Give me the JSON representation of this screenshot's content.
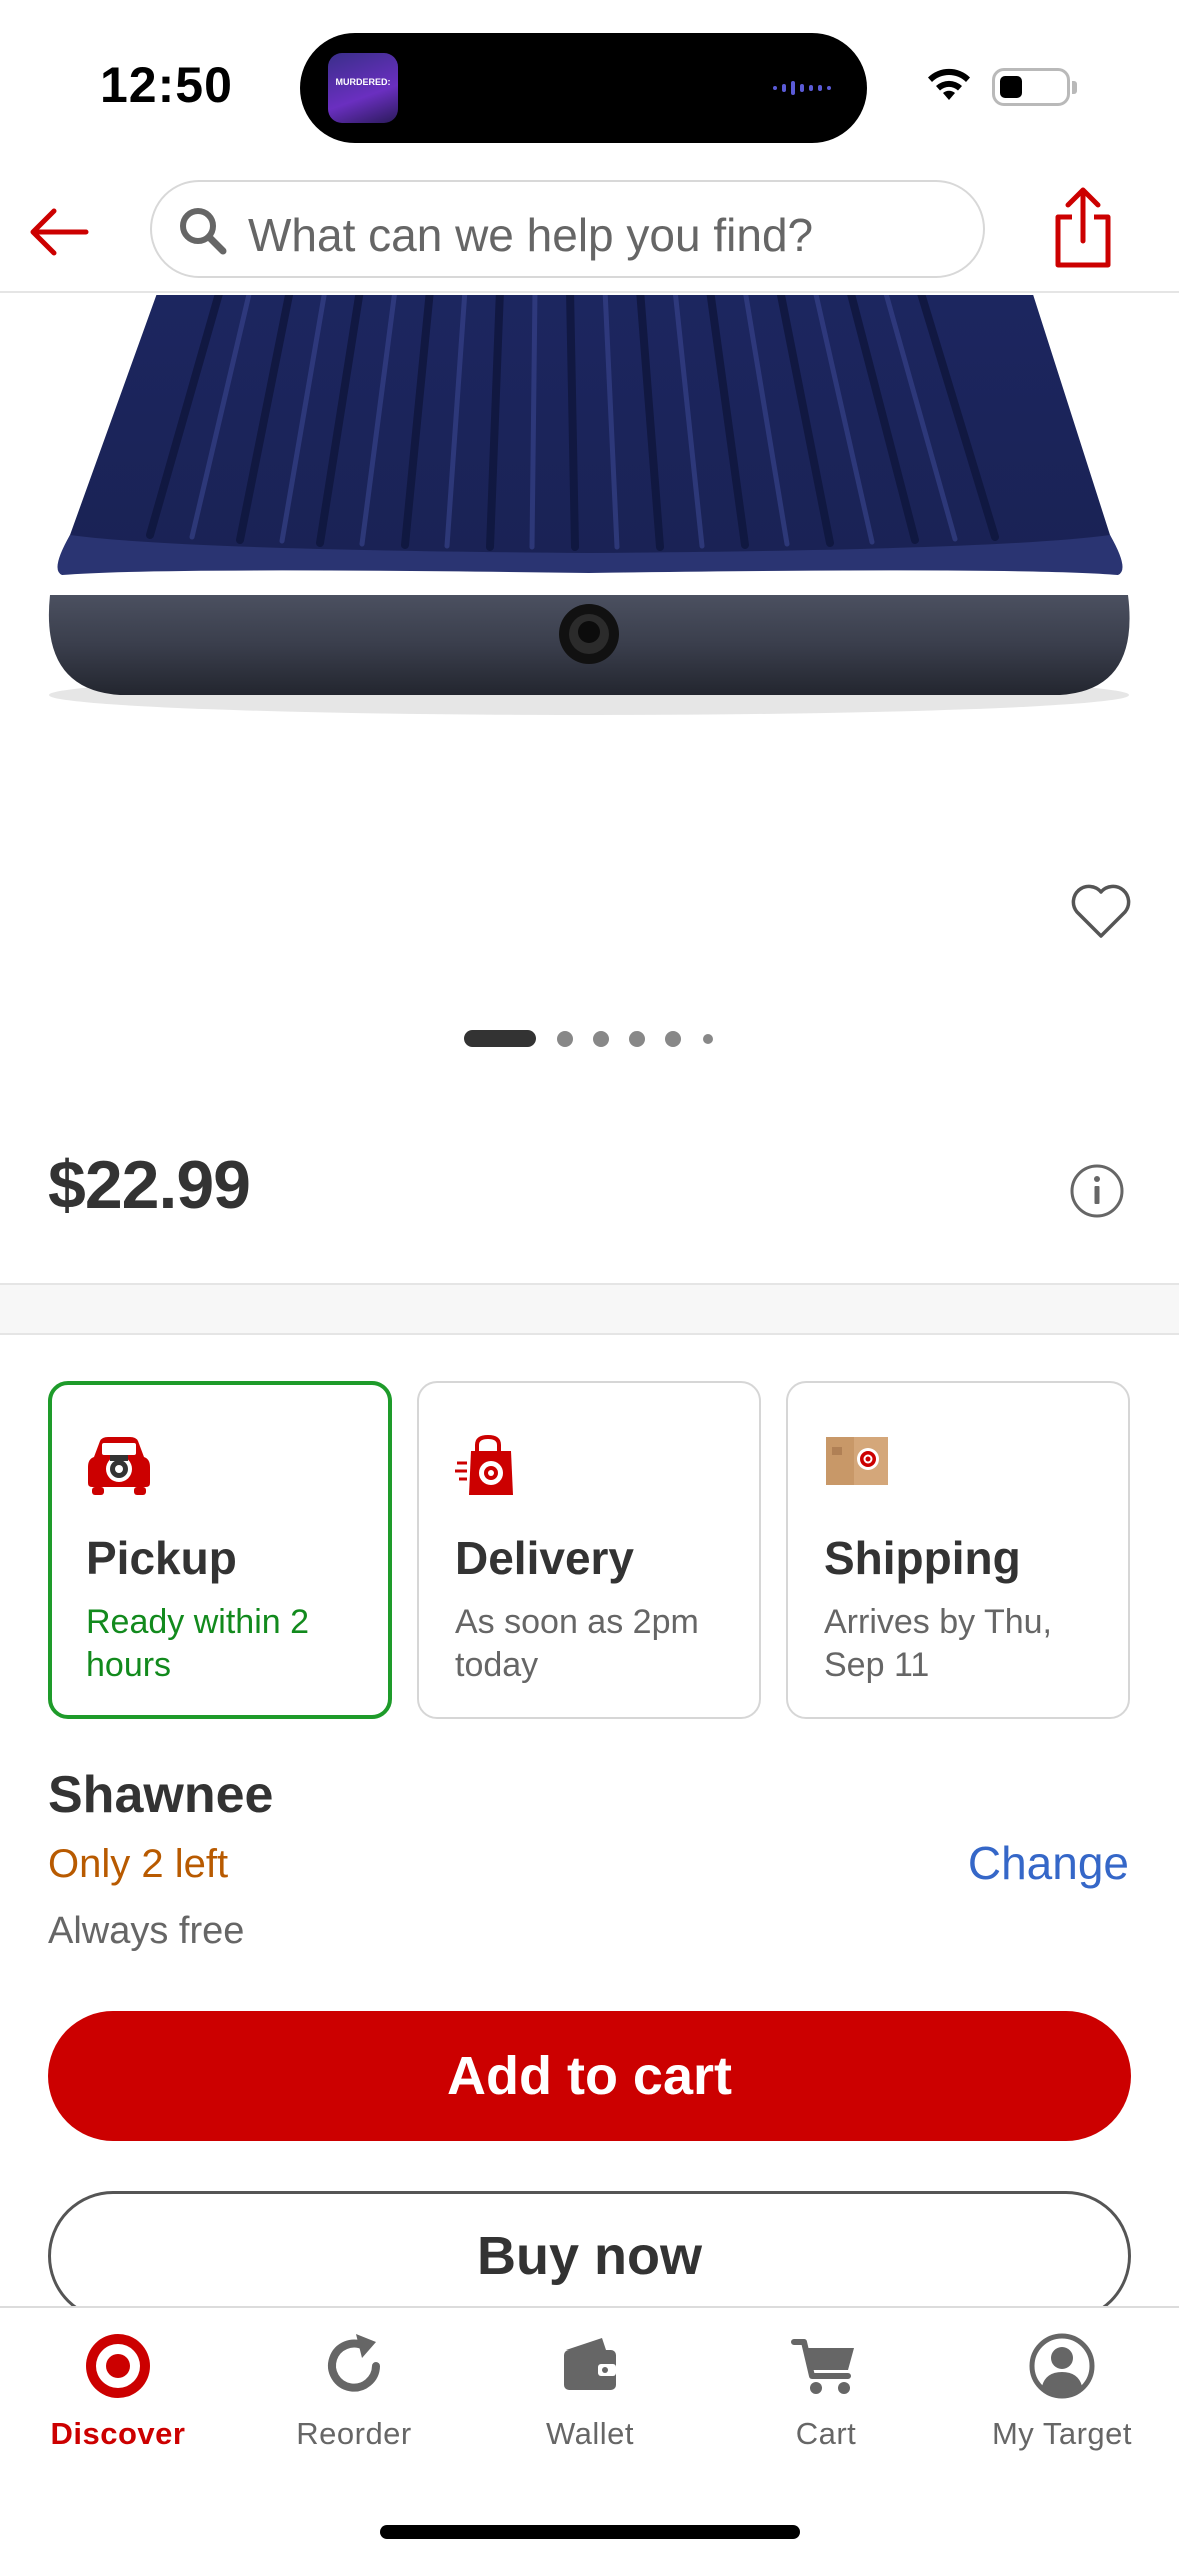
{
  "status_bar": {
    "time": "12:50",
    "live_activity_art_text": "MURDERED:",
    "icons": [
      "wifi-icon",
      "battery-icon"
    ]
  },
  "top_nav": {
    "search_placeholder": "What can we help you find?",
    "icons": [
      "back-arrow-icon",
      "search-icon",
      "share-icon"
    ]
  },
  "product": {
    "image_alt": "Blue inflatable air mattress",
    "carousel_total": 6,
    "carousel_active_index": 0,
    "price": "$22.99"
  },
  "fulfillment": {
    "options": [
      {
        "title": "Pickup",
        "subtitle": "Ready within 2 hours",
        "icon": "car-pickup-icon",
        "selected": true
      },
      {
        "title": "Delivery",
        "subtitle": "As soon as 2pm today",
        "icon": "shopping-bag-icon",
        "selected": false
      },
      {
        "title": "Shipping",
        "subtitle": "Arrives by Thu, Sep 11",
        "icon": "shipping-box-icon",
        "selected": false
      }
    ],
    "store_name": "Shawnee",
    "stock_note": "Only 2 left",
    "change_label": "Change",
    "free_note": "Always free"
  },
  "actions": {
    "add_to_cart": "Add to cart",
    "buy_now": "Buy now"
  },
  "tab_bar": {
    "items": [
      {
        "label": "Discover",
        "icon": "target-bullseye-icon",
        "active": true
      },
      {
        "label": "Reorder",
        "icon": "reorder-icon",
        "active": false
      },
      {
        "label": "Wallet",
        "icon": "wallet-icon",
        "active": false
      },
      {
        "label": "Cart",
        "icon": "cart-icon",
        "active": false
      },
      {
        "label": "My Target",
        "icon": "account-icon",
        "active": false
      }
    ]
  },
  "colors": {
    "brand_red": "#cc0000",
    "selected_green": "#1e9b2a",
    "stock_orange": "#b85a00",
    "link_blue": "#3567c8"
  }
}
